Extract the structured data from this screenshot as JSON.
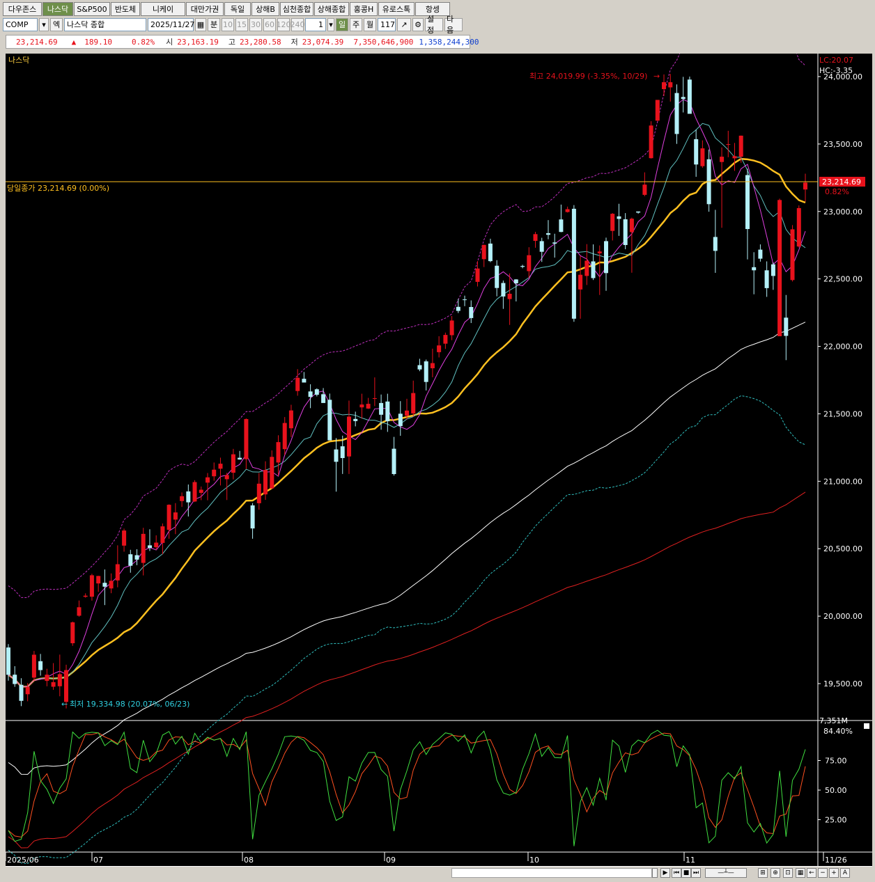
{
  "tabs": [
    {
      "label": "다우존스",
      "active": false
    },
    {
      "label": "나스닥",
      "active": true
    },
    {
      "label": "S&P500",
      "active": false
    },
    {
      "label": "반도체",
      "active": false
    },
    {
      "label": "니케이",
      "active": false
    },
    {
      "label": "대만가권",
      "active": false
    },
    {
      "label": "독일",
      "active": false
    },
    {
      "label": "상해B",
      "active": false
    },
    {
      "label": "심천종합",
      "active": false
    },
    {
      "label": "상해종합",
      "active": false
    },
    {
      "label": "홍콩H",
      "active": false
    },
    {
      "label": "유로스톡",
      "active": false
    },
    {
      "label": "항셍",
      "active": false
    }
  ],
  "toolbar": {
    "symbol": "COMP",
    "type_label": "엑",
    "name": "나스닥 종합",
    "date": "2025/11/27",
    "period_minute": "분",
    "periods": [
      "10",
      "15",
      "30",
      "60",
      "120",
      "240"
    ],
    "count": "1",
    "day_btn": "일",
    "week_btn": "주",
    "month_btn": "월",
    "bars": "117",
    "settings_btn": "설정",
    "next_btn": "다음"
  },
  "quote": {
    "last": "23,214.69",
    "arrow": "▲",
    "change": "189.10",
    "pct": "0.82%",
    "open_lbl": "시",
    "open": "23,163.19",
    "high_lbl": "고",
    "high": "23,280.58",
    "low_lbl": "저",
    "low": "23,074.39",
    "volume": "7,350,646,900",
    "amount": "1,358,244,300"
  },
  "chart": {
    "title": "나스닥",
    "lc_label": "LC:20.07",
    "hc_label": "HC:-3.35",
    "high_annotation": "최고 24,019.99 (-3.35%, 10/29)",
    "low_annotation": "최저 19,334.98 (20.07%, 06/23)",
    "close_line_label": "당일종가 23,214.69 (0.00%)",
    "price_tag": "23,214.69",
    "price_pct": "0.82%",
    "volume_label": "7,351M",
    "y_ticks": [
      "24,000.00",
      "23,500.00",
      "23,000.00",
      "22,500.00",
      "22,000.00",
      "21,500.00",
      "21,000.00",
      "20,500.00",
      "20,000.00",
      "19,500.00"
    ],
    "stoch_value": "84.40%",
    "stoch_ticks": [
      "75.00",
      "50.00",
      "25.00"
    ],
    "x_labels": [
      "2025/06",
      "07",
      "08",
      "09",
      "10",
      "11",
      "11/26"
    ],
    "colors": {
      "up": "#e8121c",
      "down": "#b4f0f8",
      "ma5": "#e040e0",
      "ma10": "#60c0c0",
      "ma20": "#ffc020",
      "ma60": "#ffffff",
      "ma120": "#e02020",
      "envelope_upper": "#c030c0",
      "envelope_lower": "#30c0c0",
      "stoch_k": "#40e040",
      "stoch_d": "#ff5020"
    }
  },
  "chart_data": {
    "type": "candlestick",
    "y_range": [
      19320,
      24150
    ],
    "candles": [
      [
        19768,
        19793,
        19522,
        19565
      ],
      [
        19566,
        19629,
        19476,
        19497
      ],
      [
        19491,
        19540,
        19333,
        19372
      ],
      [
        19421,
        19504,
        19369,
        19475
      ],
      [
        19544,
        19742,
        19522,
        19714
      ],
      [
        19666,
        19720,
        19559,
        19600
      ],
      [
        19520,
        19610,
        19480,
        19566
      ],
      [
        19477,
        19652,
        19454,
        19511
      ],
      [
        19480,
        19715,
        19406,
        19570
      ],
      [
        19364,
        19640,
        19316,
        19600
      ],
      [
        19799,
        19960,
        19780,
        19954
      ],
      [
        20003,
        20116,
        19996,
        20066
      ],
      [
        20144,
        20169,
        20137,
        20152
      ],
      [
        20144,
        20314,
        20115,
        20303
      ],
      [
        20243,
        20299,
        20180,
        20298
      ],
      [
        20247,
        20346,
        20082,
        20218
      ],
      [
        20205,
        20317,
        20170,
        20262
      ],
      [
        20265,
        20525,
        20214,
        20385
      ],
      [
        20523,
        20649,
        20478,
        20635
      ],
      [
        20459,
        20492,
        20322,
        20374
      ],
      [
        20452,
        20496,
        20378,
        20419
      ],
      [
        20395,
        20655,
        20302,
        20610
      ],
      [
        20525,
        20644,
        20483,
        20506
      ],
      [
        20511,
        20599,
        20491,
        20545
      ],
      [
        20543,
        20687,
        20459,
        20666
      ],
      [
        20640,
        20829,
        20574,
        20826
      ],
      [
        20716,
        20838,
        20608,
        20769
      ],
      [
        20853,
        20917,
        20810,
        20889
      ],
      [
        20925,
        20976,
        20739,
        20844
      ],
      [
        20850,
        21008,
        20846,
        20994
      ],
      [
        20914,
        20961,
        20860,
        20937
      ],
      [
        20990,
        21061,
        20859,
        21029
      ],
      [
        21037,
        21139,
        21004,
        21086
      ],
      [
        21093,
        21175,
        20969,
        21130
      ],
      [
        21015,
        21063,
        20861,
        21046
      ],
      [
        21063,
        21240,
        21014,
        21200
      ],
      [
        21174,
        21225,
        21160,
        21161
      ],
      [
        21164,
        21466,
        21090,
        21461
      ],
      [
        20821,
        20838,
        20574,
        20650
      ],
      [
        20837,
        21061,
        20789,
        20982
      ],
      [
        20903,
        21148,
        20862,
        21084
      ],
      [
        20948,
        21229,
        20942,
        21181
      ],
      [
        21139,
        21341,
        21040,
        21290
      ],
      [
        21238,
        21476,
        21195,
        21432
      ],
      [
        21393,
        21567,
        21328,
        21525
      ],
      [
        21669,
        21831,
        21634,
        21767
      ],
      [
        21760,
        21810,
        21743,
        21732
      ],
      [
        21666,
        21719,
        21542,
        21625
      ],
      [
        21682,
        21689,
        21629,
        21641
      ],
      [
        21645,
        21691,
        21582,
        21580
      ],
      [
        21604,
        21650,
        21326,
        21303
      ],
      [
        21236,
        21320,
        20923,
        21144
      ],
      [
        21259,
        21338,
        21054,
        21172
      ],
      [
        21184,
        21598,
        21054,
        21479
      ],
      [
        21462,
        21516,
        21407,
        21446
      ],
      [
        21548,
        21649,
        21464,
        21569
      ],
      [
        21539,
        21618,
        21536,
        21574
      ],
      [
        21615,
        21770,
        21557,
        21616
      ],
      [
        21580,
        21643,
        21382,
        21493
      ],
      [
        21591,
        21649,
        21366,
        21445
      ],
      [
        21241,
        21329,
        21042,
        21053
      ],
      [
        21501,
        21594,
        21337,
        21409
      ],
      [
        21486,
        21611,
        21458,
        21524
      ],
      [
        21503,
        21746,
        21479,
        21654
      ],
      [
        21861,
        21908,
        21816,
        21829
      ],
      [
        21889,
        21902,
        21673,
        21736
      ],
      [
        21838,
        21983,
        21771,
        21876
      ],
      [
        21957,
        22075,
        21918,
        22007
      ],
      [
        22020,
        22102,
        21981,
        22085
      ],
      [
        22083,
        22225,
        22046,
        22192
      ],
      [
        22293,
        22352,
        22247,
        22263
      ],
      [
        22348,
        22376,
        22298,
        22345
      ],
      [
        22292,
        22341,
        22173,
        22210
      ],
      [
        22478,
        22632,
        22444,
        22577
      ],
      [
        22646,
        22754,
        22588,
        22752
      ],
      [
        22762,
        22798,
        22624,
        22632
      ],
      [
        22598,
        22639,
        22371,
        22433
      ],
      [
        22470,
        22488,
        22278,
        22370
      ],
      [
        22351,
        22541,
        22159,
        22390
      ],
      [
        22496,
        22498,
        22333,
        22467
      ],
      [
        22596,
        22605,
        22579,
        22590
      ],
      [
        22558,
        22735,
        22508,
        22676
      ],
      [
        22782,
        22849,
        22731,
        22832
      ],
      [
        22780,
        22805,
        22626,
        22701
      ],
      [
        22839,
        22936,
        22794,
        22827
      ],
      [
        22770,
        22835,
        22658,
        22761
      ],
      [
        22941,
        23051,
        22846,
        22848
      ],
      [
        22996,
        23036,
        22992,
        23017
      ],
      [
        23020,
        23047,
        22182,
        22205
      ],
      [
        22422,
        22670,
        22205,
        22531
      ],
      [
        22522,
        22758,
        22455,
        22635
      ],
      [
        22630,
        22756,
        22492,
        22506
      ],
      [
        22690,
        22748,
        22381,
        22703
      ],
      [
        22780,
        22806,
        22412,
        22543
      ],
      [
        22856,
        22988,
        22785,
        22983
      ],
      [
        22964,
        23057,
        22819,
        22945
      ],
      [
        22942,
        22988,
        22720,
        22751
      ],
      [
        22847,
        22954,
        22546,
        22946
      ],
      [
        23000,
        23000,
        22984,
        22992
      ],
      [
        23123,
        23290,
        23113,
        23199
      ],
      [
        23395,
        23669,
        23392,
        23637
      ],
      [
        23673,
        23819,
        23670,
        23827
      ],
      [
        23907,
        24016,
        23856,
        23958
      ],
      [
        23920,
        24020,
        23815,
        23958
      ],
      [
        23878,
        23942,
        23501,
        23574
      ],
      [
        23849,
        23998,
        23734,
        23834
      ],
      [
        23978,
        24000,
        23728,
        23724
      ],
      [
        23536,
        23607,
        23257,
        23348
      ],
      [
        23336,
        23527,
        23324,
        23468
      ],
      [
        23387,
        23459,
        22998,
        23054
      ],
      [
        22811,
        23012,
        22545,
        22708
      ],
      [
        23367,
        23475,
        22879,
        23406
      ],
      [
        23499,
        23598,
        23402,
        23499
      ],
      [
        23394,
        23508,
        23301,
        23410
      ],
      [
        23406,
        23563,
        23361,
        23562
      ],
      [
        23270,
        23317,
        22645,
        22870
      ],
      [
        22587,
        22698,
        22386,
        22564
      ],
      [
        22717,
        22756,
        22628,
        22650
      ],
      [
        22564,
        22630,
        22367,
        22432
      ],
      [
        22608,
        22622,
        22419,
        22522
      ],
      [
        22075,
        23095,
        22075,
        23085
      ],
      [
        22213,
        22381,
        21898,
        22078
      ],
      [
        22492,
        22899,
        22481,
        22868
      ],
      [
        22740,
        23045,
        22733,
        23025
      ],
      [
        23163,
        23280,
        23074,
        23214
      ]
    ],
    "stochastic": {
      "k_last": 84.4,
      "range": [
        0,
        100
      ]
    }
  }
}
